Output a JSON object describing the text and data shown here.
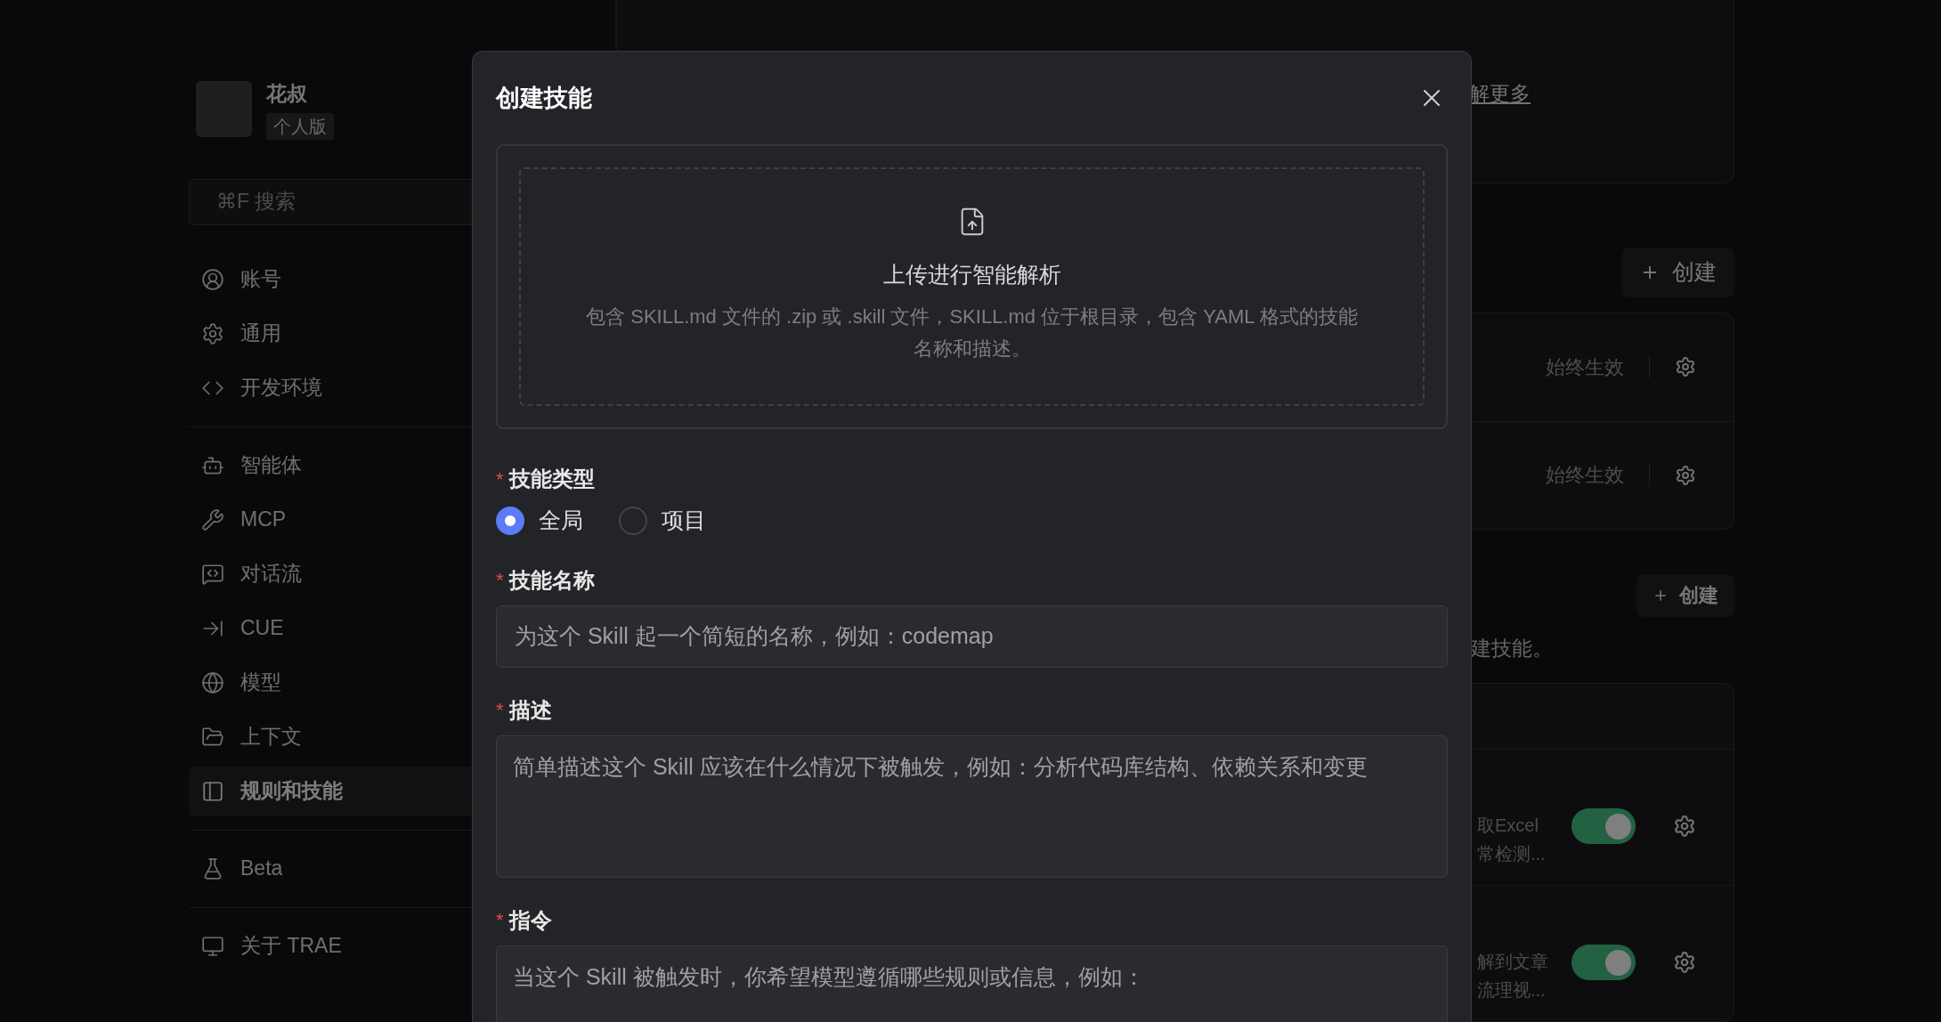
{
  "sidebar": {
    "user": {
      "name": "花叔",
      "plan": "个人版"
    },
    "search": {
      "placeholder": "⌘F 搜索"
    },
    "groups": [
      {
        "items": [
          {
            "label": "账号",
            "selected": false
          },
          {
            "label": "通用",
            "selected": false
          },
          {
            "label": "开发环境",
            "selected": false
          }
        ]
      },
      {
        "items": [
          {
            "label": "智能体",
            "selected": false
          },
          {
            "label": "MCP",
            "selected": false
          },
          {
            "label": "对话流",
            "selected": false
          },
          {
            "label": "CUE",
            "selected": false
          },
          {
            "label": "模型",
            "selected": false
          },
          {
            "label": "上下文",
            "selected": false
          },
          {
            "label": "规则和技能",
            "selected": true
          }
        ]
      },
      {
        "items": [
          {
            "label": "Beta",
            "selected": false
          }
        ]
      },
      {
        "items": [
          {
            "label": "关于 TRAE",
            "selected": false
          }
        ]
      }
    ]
  },
  "background": {
    "rules_card": {
      "link": "解更多"
    },
    "rules": {
      "create_button": "创建",
      "rows": [
        {
          "status": "始终生效"
        },
        {
          "status": "始终生效"
        }
      ]
    },
    "skills": {
      "create_button": "创建",
      "hint": "建技能。",
      "rows": [
        {
          "lines": [
            "取Excel",
            "常检测..."
          ],
          "on": true
        },
        {
          "lines": [
            "解到文章",
            "流理视..."
          ],
          "on": true
        }
      ]
    }
  },
  "modal": {
    "title": "创建技能",
    "upload": {
      "title": "上传进行智能解析",
      "description": "包含 SKILL.md 文件的 .zip 或 .skill 文件，SKILL.md 位于根目录，包含 YAML 格式的技能名称和描述。"
    },
    "fields": [
      {
        "kind": "radio",
        "label": "技能类型",
        "required_mark": "*",
        "options": [
          {
            "label": "全局",
            "selected": true
          },
          {
            "label": "项目",
            "selected": false
          }
        ]
      },
      {
        "kind": "input",
        "label": "技能名称",
        "required_mark": "*",
        "placeholder": "为这个 Skill 起一个简短的名称，例如：codemap"
      },
      {
        "kind": "textarea",
        "label": "描述",
        "required_mark": "*",
        "placeholder": "简单描述这个 Skill 应该在什么情况下被触发，例如：分析代码库结构、依赖关系和变更"
      },
      {
        "kind": "textarea",
        "label": "指令",
        "required_mark": "*",
        "placeholder": "当这个 Skill 被触发时，你希望模型遵循哪些规则或信息，例如："
      }
    ]
  }
}
